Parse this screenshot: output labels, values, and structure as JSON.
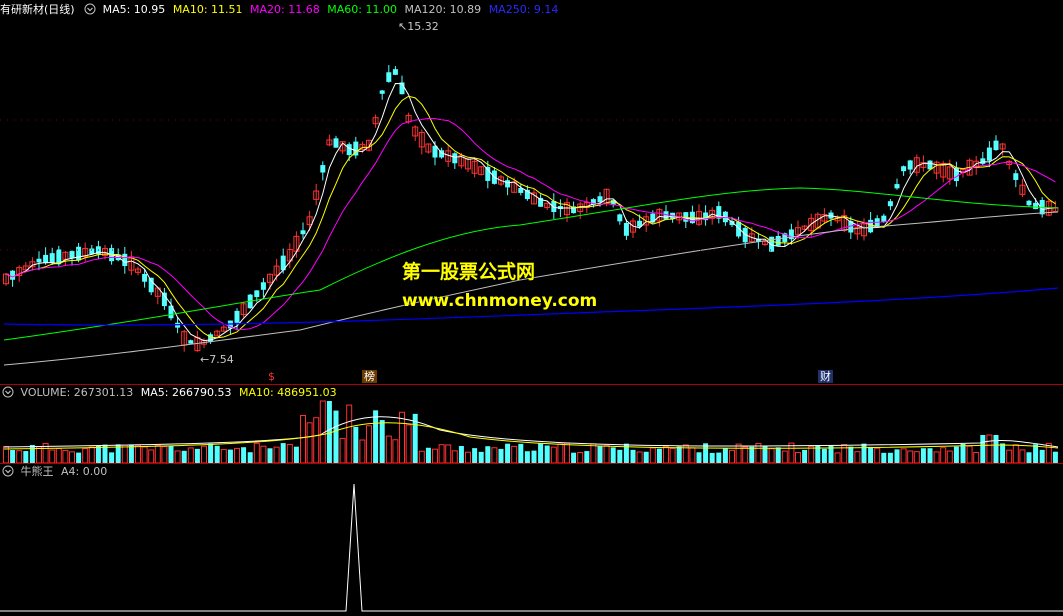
{
  "main": {
    "stock_title": "有研新材(日线)",
    "ma": [
      {
        "label": "MA5: 10.95",
        "color": "#ffffff"
      },
      {
        "label": "MA10: 11.51",
        "color": "#ffff00"
      },
      {
        "label": "MA20: 11.68",
        "color": "#ff00ff"
      },
      {
        "label": "MA60: 11.00",
        "color": "#00ff00"
      },
      {
        "label": "MA120: 10.89",
        "color": "#c0c0c0"
      },
      {
        "label": "MA250: 9.14",
        "color": "#0000ff"
      }
    ],
    "high_label": "15.32",
    "low_label": "7.54",
    "event_marks": [
      "$",
      "榜",
      "财"
    ]
  },
  "volume": {
    "title": "VOLUME: 267301.13",
    "ma5": "MA5: 266790.53",
    "ma10": "MA10: 486951.03"
  },
  "indicator": {
    "name": "牛熊王",
    "a4": "A4: 0.00"
  },
  "watermark": {
    "line1": "第一股票公式网",
    "line2": "www.chnmoney.com"
  },
  "colors": {
    "up": "#ff3232",
    "down": "#54ffff",
    "ma5": "#ffffff",
    "ma10": "#ffff00",
    "ma20": "#ff00ff",
    "ma60": "#00ff00",
    "ma120": "#c0c0c0",
    "ma250": "#0000ff",
    "separator": "#b00000"
  },
  "icons": {
    "settings": "circle-chevron-icon"
  }
}
